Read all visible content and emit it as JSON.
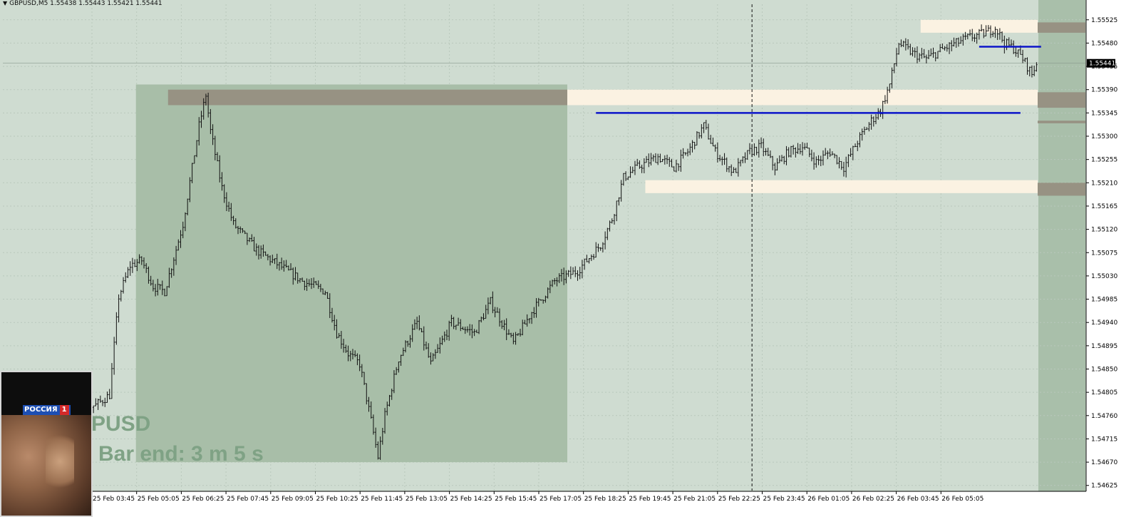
{
  "header": {
    "symbol_line": "GBPUSD,M5  1.55438 1.55443 1.55421 1.55441"
  },
  "overlay": {
    "symbol_watermark": "PUSD",
    "bar_end": "Bar end: 3 m 5 s"
  },
  "video": {
    "channel_name": "РОССИЯ",
    "channel_number": "1"
  },
  "colors": {
    "background": "#cfdcd1",
    "shaded_zone": "#a8bea8",
    "supply_zone_dark": "#979283",
    "zone_light": "#fbf2e2",
    "line_blue": "#0b14c9",
    "candle": "#111111",
    "right_band": "#a9bfaa"
  },
  "chart_data": {
    "type": "candlestick",
    "symbol": "GBPUSD",
    "timeframe": "M5",
    "last_price": 1.55441,
    "price_range": [
      1.54615,
      1.55555
    ],
    "y_ticks": [
      "1.55525",
      "1.55480",
      "1.55435",
      "1.55390",
      "1.55345",
      "1.55300",
      "1.55255",
      "1.55210",
      "1.55165",
      "1.55120",
      "1.55075",
      "1.55030",
      "1.54985",
      "1.54940",
      "1.54895",
      "1.54850",
      "1.54805",
      "1.54760",
      "1.54715",
      "1.54670",
      "1.54625"
    ],
    "x_ticks": [
      "25 Feb 03:45",
      "25 Feb 05:05",
      "25 Feb 06:25",
      "25 Feb 07:45",
      "25 Feb 09:05",
      "25 Feb 10:25",
      "25 Feb 11:45",
      "25 Feb 13:05",
      "25 Feb 14:25",
      "25 Feb 15:45",
      "25 Feb 17:05",
      "25 Feb 18:25",
      "25 Feb 19:45",
      "25 Feb 21:05",
      "25 Feb 22:25",
      "25 Feb 23:45",
      "26 Feb 01:05",
      "26 Feb 02:25",
      "26 Feb 03:45",
      "26 Feb 05:05"
    ],
    "price_path": [
      [
        0,
        1.54755
      ],
      [
        10,
        1.54765
      ],
      [
        20,
        1.5479
      ],
      [
        30,
        1.5477
      ],
      [
        40,
        1.5478
      ],
      [
        46,
        1.548
      ],
      [
        50,
        1.5499
      ],
      [
        55,
        1.5505
      ],
      [
        60,
        1.5506
      ],
      [
        65,
        1.5501
      ],
      [
        70,
        1.55
      ],
      [
        78,
        1.5513
      ],
      [
        85,
        1.5532
      ],
      [
        88,
        1.5538
      ],
      [
        90,
        1.5531
      ],
      [
        95,
        1.552
      ],
      [
        100,
        1.5513
      ],
      [
        110,
        1.5508
      ],
      [
        120,
        1.5505
      ],
      [
        130,
        1.5502
      ],
      [
        140,
        1.55
      ],
      [
        145,
        1.5492
      ],
      [
        150,
        1.5488
      ],
      [
        155,
        1.5486
      ],
      [
        160,
        1.5475
      ],
      [
        163,
        1.5468
      ],
      [
        166,
        1.5476
      ],
      [
        172,
        1.5487
      ],
      [
        180,
        1.5494
      ],
      [
        186,
        1.5486
      ],
      [
        195,
        1.5494
      ],
      [
        205,
        1.5492
      ],
      [
        212,
        1.5498
      ],
      [
        222,
        1.549
      ],
      [
        230,
        1.5496
      ],
      [
        240,
        1.5502
      ],
      [
        250,
        1.5504
      ],
      [
        260,
        1.5509
      ],
      [
        265,
        1.5514
      ],
      [
        270,
        1.5522
      ],
      [
        276,
        1.5524
      ],
      [
        285,
        1.5526
      ],
      [
        292,
        1.5524
      ],
      [
        298,
        1.5527
      ],
      [
        305,
        1.5532
      ],
      [
        310,
        1.5527
      ],
      [
        318,
        1.5523
      ],
      [
        325,
        1.5527
      ],
      [
        330,
        1.5528
      ],
      [
        336,
        1.5524
      ],
      [
        342,
        1.5527
      ],
      [
        348,
        1.5528
      ],
      [
        354,
        1.5525
      ],
      [
        360,
        1.5527
      ],
      [
        366,
        1.5524
      ],
      [
        372,
        1.5529
      ],
      [
        378,
        1.5533
      ],
      [
        382,
        1.5535
      ],
      [
        386,
        1.554
      ],
      [
        390,
        1.5548
      ],
      [
        396,
        1.5546
      ],
      [
        402,
        1.5545
      ],
      [
        410,
        1.5547
      ],
      [
        420,
        1.5549
      ],
      [
        428,
        1.555
      ],
      [
        432,
        1.5551
      ],
      [
        436,
        1.5548
      ],
      [
        440,
        1.5547
      ],
      [
        444,
        1.5545
      ],
      [
        448,
        1.5542
      ],
      [
        450,
        1.55441
      ]
    ],
    "n_bars": 451,
    "zones": [
      {
        "role": "shaded_box",
        "from_bar": 58,
        "to_bar": 246,
        "price_top": 1.554,
        "price_bottom": 1.5467
      },
      {
        "role": "dark_zone",
        "from_bar": 72,
        "to_bar": 246,
        "price_top": 1.5539,
        "price_bottom": 1.5536
      },
      {
        "role": "light_zone",
        "from_bar": 246,
        "to_bar": 451,
        "price_top": 1.5539,
        "price_bottom": 1.5536
      },
      {
        "role": "light_zone",
        "from_bar": 400,
        "to_bar": 451,
        "price_top": 1.55525,
        "price_bottom": 1.555
      },
      {
        "role": "light_zone",
        "from_bar": 280,
        "to_bar": 451,
        "price_top": 1.55215,
        "price_bottom": 1.5519
      },
      {
        "role": "right_dark",
        "from_bar": 451,
        "to_bar": 475,
        "price_top": 1.5552,
        "price_bottom": 1.555
      },
      {
        "role": "right_dark",
        "from_bar": 451,
        "to_bar": 475,
        "price_top": 1.55385,
        "price_bottom": 1.55355
      },
      {
        "role": "right_dark",
        "from_bar": 451,
        "to_bar": 475,
        "price_top": 1.5533,
        "price_bottom": 1.55325
      },
      {
        "role": "right_dark",
        "from_bar": 451,
        "to_bar": 475,
        "price_top": 1.5521,
        "price_bottom": 1.55185
      }
    ],
    "hlines": [
      {
        "from_bar": 258,
        "to_bar": 443,
        "price": 1.55345
      },
      {
        "from_bar": 425,
        "to_bar": 452,
        "price": 1.55473
      }
    ],
    "vline_bar": 326,
    "bid_line": 1.55441
  }
}
